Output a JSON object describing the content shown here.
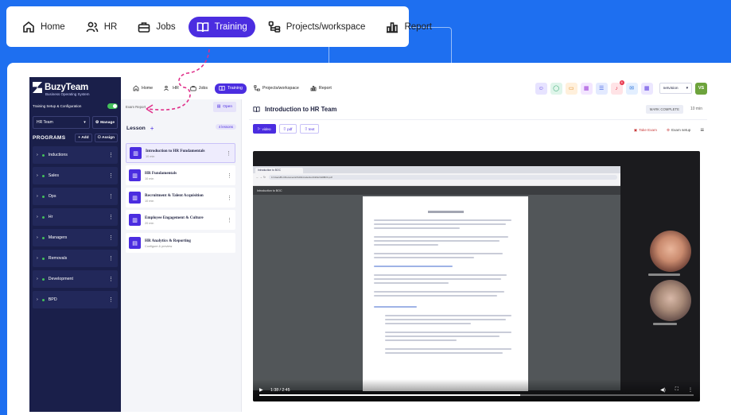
{
  "top_nav": {
    "items": [
      {
        "label": "Home",
        "icon": "home-icon",
        "active": false
      },
      {
        "label": "HR",
        "icon": "users-icon",
        "active": false
      },
      {
        "label": "Jobs",
        "icon": "briefcase-icon",
        "active": false
      },
      {
        "label": "Training",
        "icon": "book-icon",
        "active": true
      },
      {
        "label": "Projects/workspace",
        "icon": "projects-icon",
        "active": false
      },
      {
        "label": "Report",
        "icon": "bar-chart-icon",
        "active": false
      }
    ]
  },
  "sidebar": {
    "logo_title": "BuzyTeam",
    "logo_subtitle": "Business Operating System",
    "config_label": "Training Setup & Configuration",
    "team_select": "HR Team",
    "manage_label": "Manage",
    "programs_label": "PROGRAMS",
    "add_label": "Add",
    "assign_label": "Assign",
    "items": [
      {
        "label": "Inductions"
      },
      {
        "label": "Sales"
      },
      {
        "label": "Ops"
      },
      {
        "label": "Hr"
      },
      {
        "label": "Managers"
      },
      {
        "label": "Removals"
      },
      {
        "label": "Development"
      },
      {
        "label": "BPD"
      }
    ]
  },
  "header": {
    "items": [
      {
        "label": "Home",
        "active": false
      },
      {
        "label": "HR",
        "active": false
      },
      {
        "label": "Jobs",
        "active": false
      },
      {
        "label": "Training",
        "active": true
      },
      {
        "label": "Projects/workspace",
        "active": false
      },
      {
        "label": "Report",
        "active": false
      }
    ],
    "icons": [
      {
        "name": "people-icon",
        "bg": "#e7e3ff",
        "fg": "#4b2de0",
        "glyph": "☺"
      },
      {
        "name": "chat-icon",
        "bg": "#dff5ea",
        "fg": "#1f9d62",
        "glyph": "◯"
      },
      {
        "name": "clipboard-icon",
        "bg": "#fff0dc",
        "fg": "#e08a1e",
        "glyph": "▭"
      },
      {
        "name": "calendar-icon",
        "bg": "#f3e6ff",
        "fg": "#9b3bd8",
        "glyph": "▦"
      },
      {
        "name": "checklist-icon",
        "bg": "#e3eaff",
        "fg": "#3a5be0",
        "glyph": "☰"
      },
      {
        "name": "bell-icon",
        "bg": "#ffe3e6",
        "fg": "#e8384f",
        "glyph": "♪"
      },
      {
        "name": "mail-icon",
        "bg": "#e3efff",
        "fg": "#2b72d8",
        "glyph": "✉"
      },
      {
        "name": "calendar-alt-icon",
        "bg": "#ece7ff",
        "fg": "#5a3ae0",
        "glyph": "▦"
      }
    ],
    "notification_count": "6",
    "org_select": "netvision",
    "avatar_initials": "VS"
  },
  "lesson_panel": {
    "exam_report": "Exam Report",
    "open_label": "Open",
    "heading": "Lesson",
    "count_badge": "4 lessons",
    "lessons": [
      {
        "title": "Introduction  to HR Fundamentals",
        "duration": "10 min",
        "selected": true,
        "icon": "book-icon"
      },
      {
        "title": "HR Fundamentals",
        "duration": "10 min",
        "selected": false,
        "icon": "book-icon"
      },
      {
        "title": "Recruitment & Talent Acquisition",
        "duration": "10 min",
        "selected": false,
        "icon": "book-icon"
      },
      {
        "title": "Employee Engagement & Culture",
        "duration": "20 min",
        "selected": false,
        "icon": "book-icon"
      },
      {
        "title": "HR Analytics & Reporting",
        "duration": "Configure & preview",
        "selected": false,
        "icon": "document-icon"
      }
    ]
  },
  "content": {
    "title": "Introduction  to HR Team",
    "mark_complete": "MARK COMPLETE",
    "duration": "10 min",
    "tabs": [
      {
        "label": "video",
        "active": true,
        "icon": "play-icon"
      },
      {
        "label": "pdf",
        "active": false,
        "icon": "file-icon"
      },
      {
        "label": "text",
        "active": false,
        "icon": "file-icon"
      }
    ],
    "take_exam": "Take Exam",
    "exam_setup": "Exam setup"
  },
  "video": {
    "browser_tab": "Introduction to BOC",
    "url": "C:/Users/B-C/Documents/%20Introduction%20to%20BOC.pdf",
    "pdf_name": "Introduction to BOC",
    "time": "1:38 / 2:45",
    "progress": 0.6
  }
}
